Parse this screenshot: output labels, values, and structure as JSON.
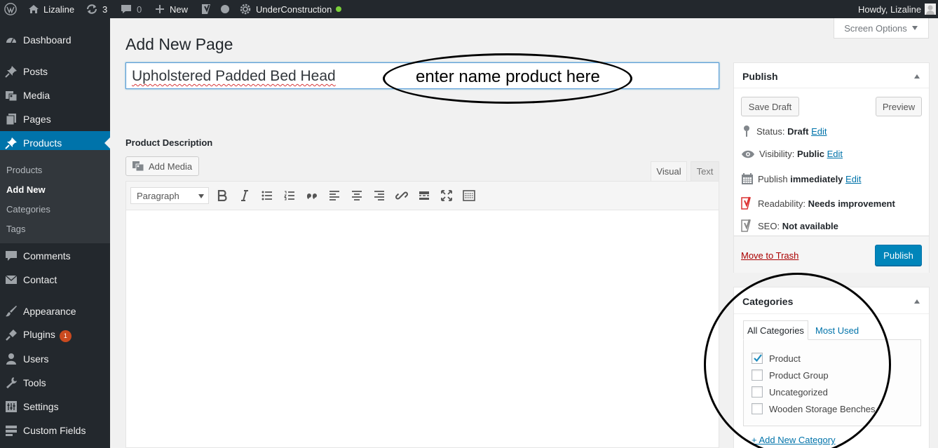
{
  "adminbar": {
    "site_name": "Lizaline",
    "updates_count": "3",
    "comments_count": "0",
    "new_label": "New",
    "plugin_name": "UnderConstruction",
    "greeting": "Howdy, Lizaline"
  },
  "sidebar": {
    "items": [
      {
        "label": "Dashboard",
        "icon": "dashboard-icon"
      },
      {
        "label": "Posts",
        "icon": "pin-icon"
      },
      {
        "label": "Media",
        "icon": "media-icon"
      },
      {
        "label": "Pages",
        "icon": "pages-icon"
      },
      {
        "label": "Products",
        "icon": "pin-icon"
      },
      {
        "label": "Comments",
        "icon": "comment-icon"
      },
      {
        "label": "Contact",
        "icon": "mail-icon"
      },
      {
        "label": "Appearance",
        "icon": "brush-icon"
      },
      {
        "label": "Plugins",
        "icon": "plugin-icon",
        "badge": "1"
      },
      {
        "label": "Users",
        "icon": "user-icon"
      },
      {
        "label": "Tools",
        "icon": "wrench-icon"
      },
      {
        "label": "Settings",
        "icon": "settings-icon"
      },
      {
        "label": "Custom Fields",
        "icon": "fields-icon"
      }
    ],
    "submenu": [
      "Products",
      "Add New",
      "Categories",
      "Tags"
    ]
  },
  "screen_options": "Screen Options",
  "page_title": "Add New Page",
  "title_input": "Upholstered Padded Bed Head",
  "annotation_title": "enter name product here",
  "description_label": "Product Description",
  "add_media": "Add Media",
  "editor_tabs": {
    "visual": "Visual",
    "text": "Text"
  },
  "format_select": "Paragraph",
  "publish": {
    "title": "Publish",
    "save_draft": "Save Draft",
    "preview": "Preview",
    "status_label": "Status:",
    "status_value": "Draft",
    "visibility_label": "Visibility:",
    "visibility_value": "Public",
    "publish_label": "Publish",
    "publish_value": "immediately",
    "edit": "Edit",
    "readability_label": "Readability:",
    "readability_value": "Needs improvement",
    "seo_label": "SEO:",
    "seo_value": "Not available",
    "trash": "Move to Trash",
    "publish_button": "Publish"
  },
  "categories": {
    "title": "Categories",
    "tab_all": "All Categories",
    "tab_most": "Most Used",
    "items": [
      {
        "label": "Product",
        "checked": true
      },
      {
        "label": "Product Group",
        "checked": false
      },
      {
        "label": "Uncategorized",
        "checked": false
      },
      {
        "label": "Wooden Storage Benches",
        "checked": false
      }
    ],
    "add_new": "+ Add New Category"
  },
  "colors": {
    "accent": "#0073aa",
    "sidebar": "#23282d",
    "readability": "#dc3232",
    "checkmark": "#1e8cbe"
  }
}
